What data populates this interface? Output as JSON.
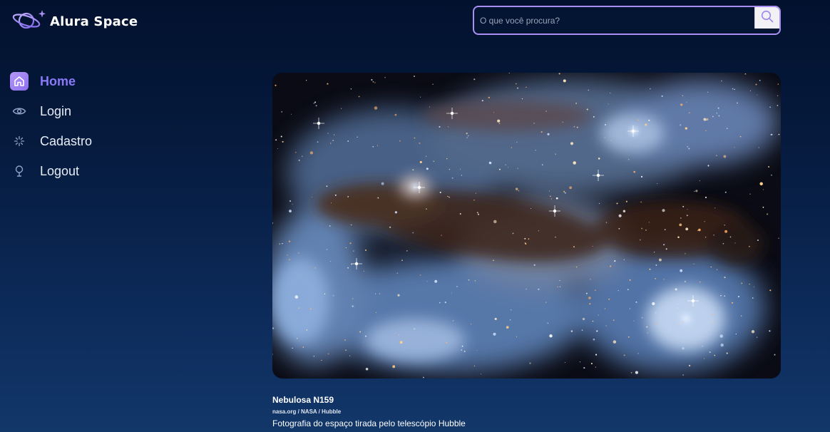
{
  "header": {
    "logo_text": "Alura Space",
    "logo_icon": "planet-icon",
    "search": {
      "placeholder": "O que você procura?",
      "value": "",
      "button_icon": "search-icon"
    }
  },
  "sidebar": {
    "items": [
      {
        "label": "Home",
        "icon": "home-icon",
        "active": true
      },
      {
        "label": "Login",
        "icon": "eye-icon",
        "active": false
      },
      {
        "label": "Cadastro",
        "icon": "sparkle-icon",
        "active": false
      },
      {
        "label": "Logout",
        "icon": "bulb-icon",
        "active": false
      }
    ]
  },
  "main": {
    "photo": {
      "title": "Nebulosa N159",
      "source": "nasa.org / NASA / Hubble",
      "description": "Fotografia do espaço tirada pelo telescópio Hubble"
    }
  },
  "colors": {
    "accent": "#8a79f6",
    "search_border": "#a98ff1",
    "background_top": "#02112e",
    "background_bottom": "#123769"
  }
}
